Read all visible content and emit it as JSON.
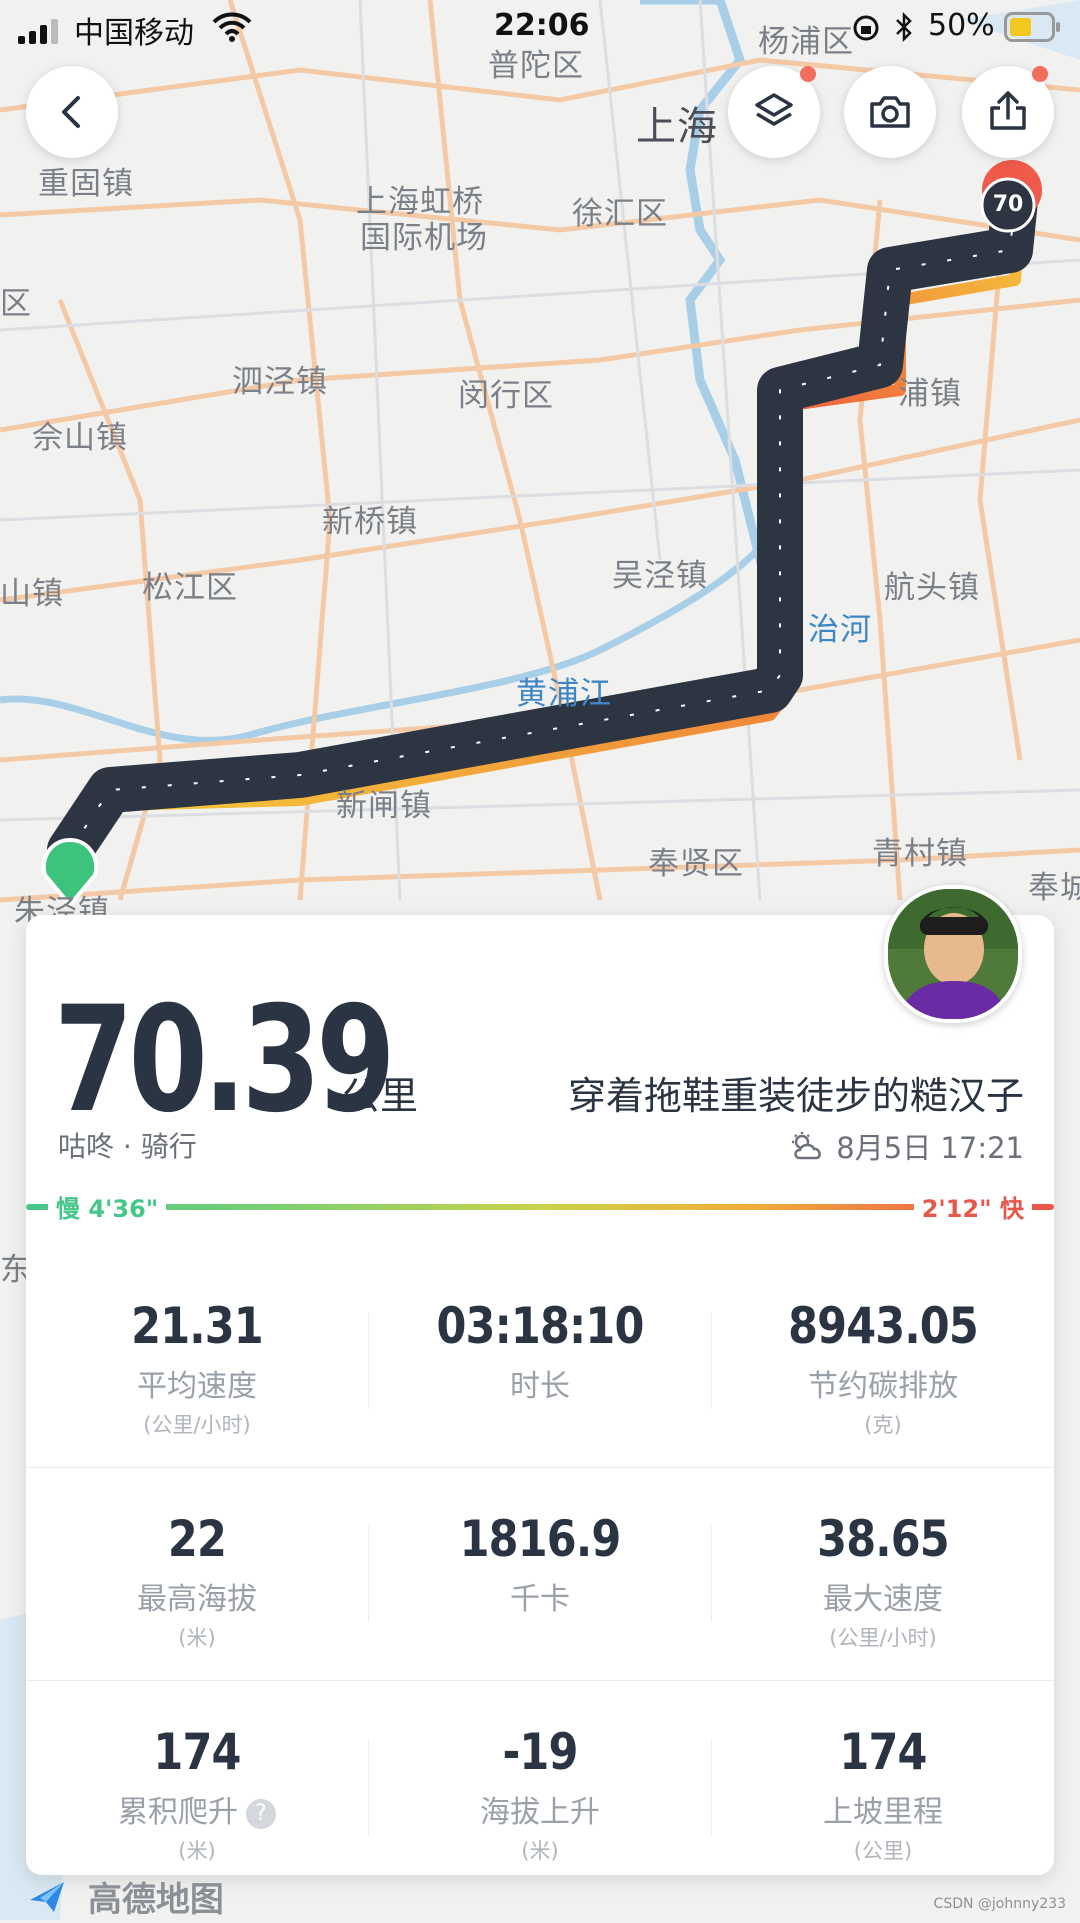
{
  "status_bar": {
    "carrier": "中国移动",
    "time": "22:06",
    "battery": "50%"
  },
  "map": {
    "labels": [
      "杨浦区",
      "普陀区",
      "上海",
      "重固镇",
      "上海虹桥",
      "国际机场",
      "徐汇区",
      "区",
      "泗泾镇",
      "闵行区",
      "佘山镇",
      "浦镇",
      "新桥镇",
      "山镇",
      "松江区",
      "吴泾镇",
      "航头镇",
      "治河",
      "黄浦江",
      "新闸镇",
      "奉贤区",
      "青村镇",
      "奉城",
      "朱泾镇",
      "东镇"
    ],
    "route_marker_end": "70",
    "attribution": "高德地图"
  },
  "summary": {
    "distance": "70.39",
    "unit": "公里",
    "app_activity": "咕咚 · 骑行",
    "author": "穿着拖鞋重装徒步的糙汉子",
    "datetime": "8月5日 17:21",
    "pace_slow": "慢 4'36\"",
    "pace_fast": "2'12\" 快"
  },
  "stats": [
    {
      "value": "21.31",
      "label": "平均速度",
      "unit": "(公里/小时)"
    },
    {
      "value": "03:18:10",
      "label": "时长",
      "unit": ""
    },
    {
      "value": "8943.05",
      "label": "节约碳排放",
      "unit": "(克)"
    },
    {
      "value": "22",
      "label": "最高海拔",
      "unit": "(米)"
    },
    {
      "value": "1816.9",
      "label": "千卡",
      "unit": ""
    },
    {
      "value": "38.65",
      "label": "最大速度",
      "unit": "(公里/小时)"
    },
    {
      "value": "174",
      "label": "累积爬升",
      "unit": "(米)"
    },
    {
      "value": "-19",
      "label": "海拔上升",
      "unit": "(米)"
    },
    {
      "value": "174",
      "label": "上坡里程",
      "unit": "(公里)"
    }
  ],
  "watermark": "CSDN @johnny233",
  "colors": {
    "dark": "#2a3443",
    "start_green": "#3dc37b",
    "end_red": "#ef5a4a",
    "pace_slow": "#45c789",
    "pace_fast": "#e8564a"
  }
}
